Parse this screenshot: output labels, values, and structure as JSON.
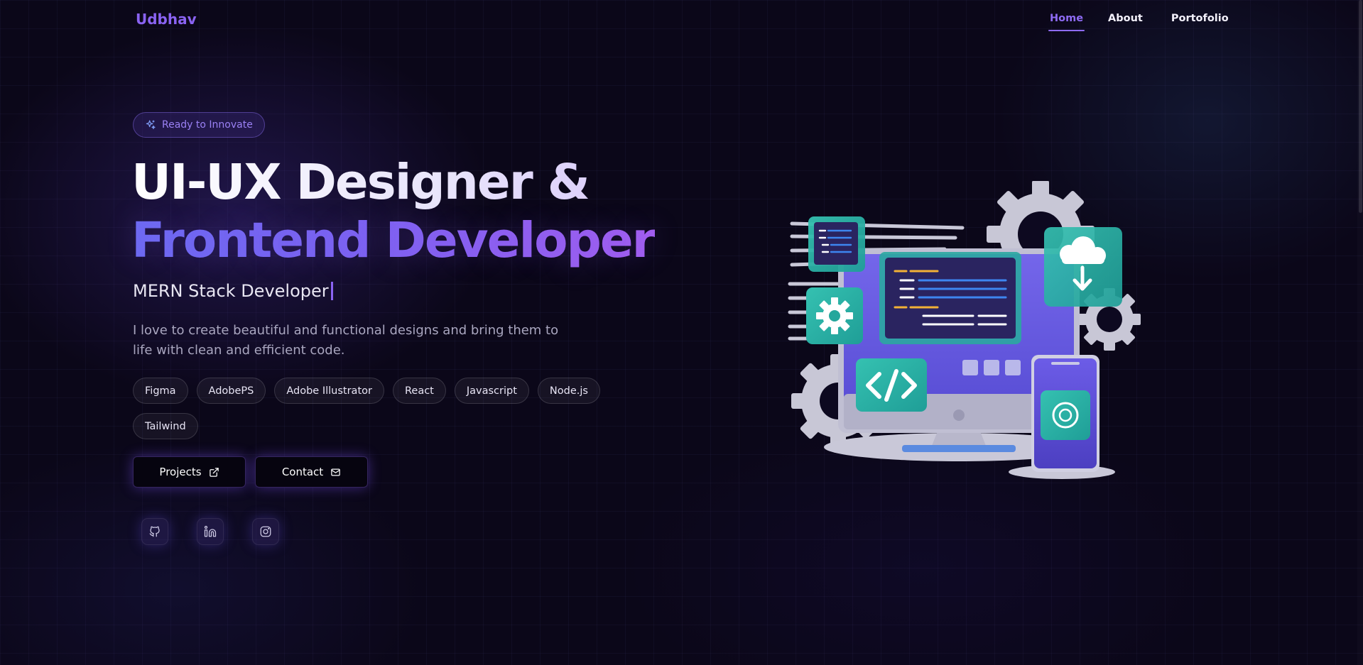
{
  "header": {
    "logo": "Udbhav",
    "nav": [
      {
        "label": "Home",
        "active": true
      },
      {
        "label": "About",
        "active": false
      },
      {
        "label": "Portofolio",
        "active": false
      }
    ]
  },
  "hero": {
    "badge": {
      "icon": "sparkles-icon",
      "label": "Ready to Innovate"
    },
    "title_line1": "UI-UX Designer &",
    "title_line2": "Frontend Developer",
    "typed_text": "MERN Stack Developer",
    "description": "I love to create beautiful and functional designs and bring them to life with clean and efficient code.",
    "skills": [
      "Figma",
      "AdobePS",
      "Adobe Illustrator",
      "React",
      "Javascript",
      "Node.js",
      "Tailwind"
    ],
    "buttons": [
      {
        "label": "Projects",
        "icon": "external-link-icon"
      },
      {
        "label": "Contact",
        "icon": "mail-icon"
      }
    ],
    "socials": [
      {
        "icon": "github-icon"
      },
      {
        "icon": "linkedin-icon"
      },
      {
        "icon": "instagram-icon"
      }
    ]
  },
  "colors": {
    "background": "#0b0719",
    "accent": "#8b63f2",
    "teal": "#2fb8a8",
    "monitor": "#6c5ce7"
  }
}
